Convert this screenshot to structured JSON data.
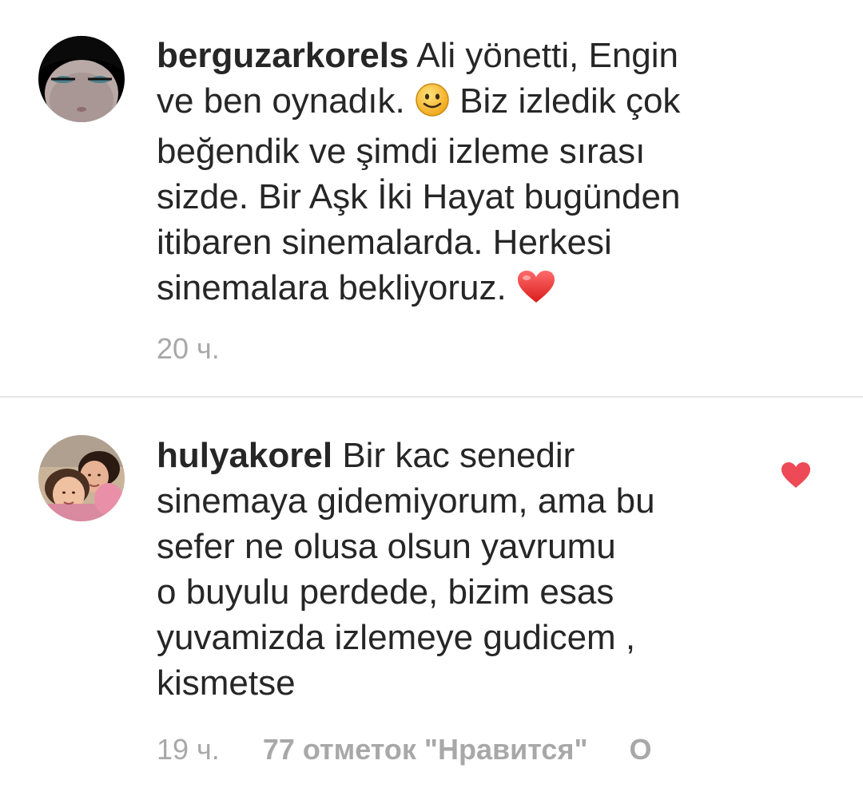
{
  "comments": [
    {
      "username": "berguzarkorels",
      "text_part1": "Ali yönetti, Engin\nve ben oynadık. ",
      "text_part2": " Biz izledik çok\nbeğendik ve şimdi izleme sırası\nsizde. Bir Aşk İki Hayat bugünden\nitibaren sinemalarda. Herkesi\nsinemalara bekliyoruz. ",
      "emoji1": "slightly-smiling-face-icon",
      "emoji2": "red-heart-icon",
      "time": "20 ч.",
      "liked": false
    },
    {
      "username": "hulyakorel",
      "text": "Bir kac senedir\nsinemaya gidemiyorum, ama bu\nsefer ne olusa olsun yavrumu\no buyulu perdede, bizim esas\nyuvamizda izlemeye gudicem ,\nkismetse",
      "time": "19 ч.",
      "likes": "77 отметок \"Нравится\"",
      "reply": "О",
      "liked": true,
      "like_icon": "heart-icon"
    }
  ],
  "colors": {
    "text": "#262626",
    "meta": "#a8a8a8",
    "heart": "#ed4956",
    "divider": "#e6e6e6"
  }
}
